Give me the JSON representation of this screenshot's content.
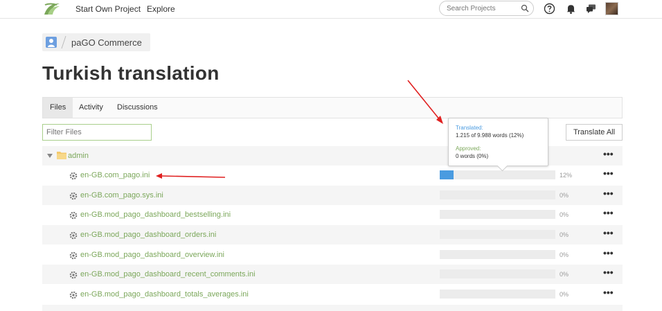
{
  "nav": {
    "links": [
      "Start Own Project",
      "Explore"
    ],
    "search_placeholder": "Search Projects",
    "accent": "#7ba75a"
  },
  "breadcrumb": {
    "label": "paGO Commerce"
  },
  "page": {
    "title": "Turkish translation"
  },
  "tabs": [
    {
      "label": "Files",
      "active": true
    },
    {
      "label": "Activity",
      "active": false
    },
    {
      "label": "Discussions",
      "active": false
    }
  ],
  "filter": {
    "placeholder": "Filter Files"
  },
  "actions": {
    "translate_all": "Translate All"
  },
  "tooltip": {
    "translated_heading": "Translated:",
    "translated_value": "1.215 of 9.988 words (12%)",
    "approved_heading": "Approved:",
    "approved_value": "0 words (0%)"
  },
  "folder": {
    "name": "admin"
  },
  "files": [
    {
      "name": "en-GB.com_pago.ini",
      "percent_label": "12%",
      "progress": 0.12
    },
    {
      "name": "en-GB.com_pago.sys.ini",
      "percent_label": "0%",
      "progress": 0
    },
    {
      "name": "en-GB.mod_pago_dashboard_bestselling.ini",
      "percent_label": "0%",
      "progress": 0
    },
    {
      "name": "en-GB.mod_pago_dashboard_orders.ini",
      "percent_label": "0%",
      "progress": 0
    },
    {
      "name": "en-GB.mod_pago_dashboard_overview.ini",
      "percent_label": "0%",
      "progress": 0
    },
    {
      "name": "en-GB.mod_pago_dashboard_recent_comments.ini",
      "percent_label": "0%",
      "progress": 0
    },
    {
      "name": "en-GB.mod_pago_dashboard_totals_averages.ini",
      "percent_label": "0%",
      "progress": 0
    }
  ],
  "more_label": "•••",
  "colors": {
    "progress": "#4a9be0",
    "link_green": "#7ba75a",
    "tooltip_heading_blue": "#4a9be0",
    "tooltip_heading_green": "#7ba75a",
    "annotation_arrow": "#e02020"
  }
}
